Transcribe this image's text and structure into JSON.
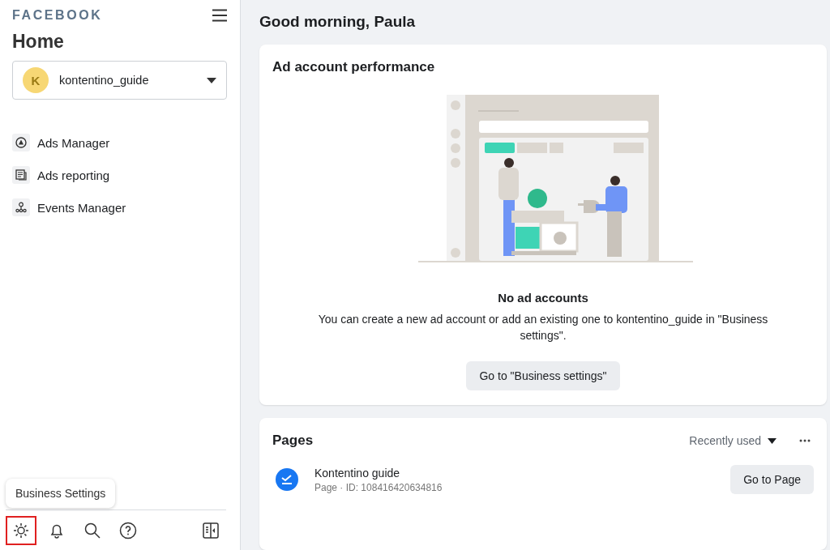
{
  "sidebar": {
    "brand": "FACEBOOK",
    "title": "Home",
    "account": {
      "initial": "K",
      "name": "kontentino_guide"
    },
    "nav": [
      {
        "kind": "ads-manager",
        "label": "Ads Manager"
      },
      {
        "kind": "ads-reporting",
        "label": "Ads reporting"
      },
      {
        "kind": "events-manager",
        "label": "Events Manager"
      }
    ],
    "tooltip": "Business Settings",
    "tools": [
      {
        "kind": "settings",
        "highlighted": true
      },
      {
        "kind": "notifications",
        "highlighted": false
      },
      {
        "kind": "search",
        "highlighted": false
      },
      {
        "kind": "help",
        "highlighted": false
      },
      {
        "kind": "panel",
        "highlighted": false
      }
    ]
  },
  "greeting": "Good morning, Paula",
  "performance": {
    "title": "Ad account performance",
    "empty_title": "No ad accounts",
    "empty_text": "You can create a new ad account or add an existing one to kontentino_guide in \"Business settings\".",
    "button": "Go to \"Business settings\""
  },
  "pages": {
    "title": "Pages",
    "sort": "Recently used",
    "items": [
      {
        "name": "Kontentino guide",
        "meta": "Page · ID: 108416420634816",
        "button": "Go to Page"
      }
    ]
  }
}
